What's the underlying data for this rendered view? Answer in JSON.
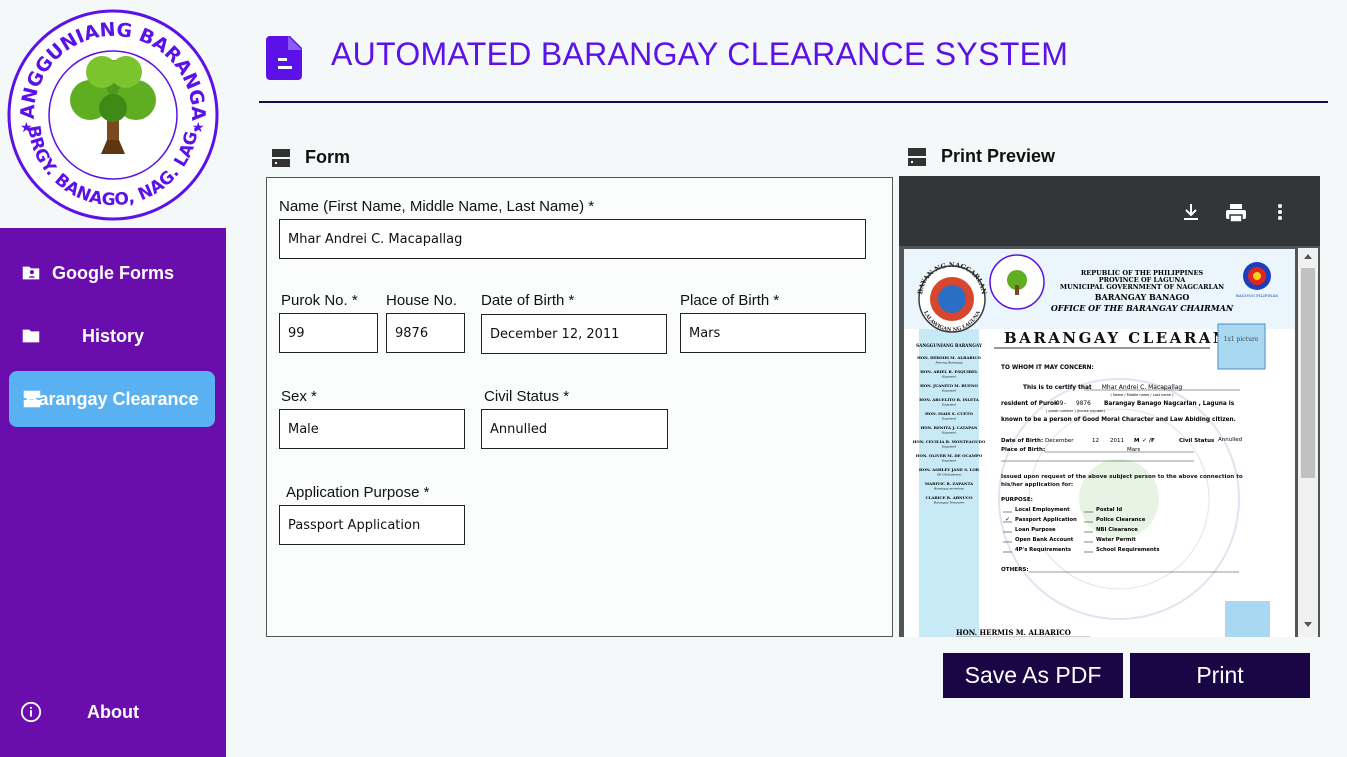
{
  "app": {
    "title": "AUTOMATED BARANGAY CLEARANCE SYSTEM"
  },
  "colors": {
    "sidebar": "#6a0dad",
    "active_item": "#5ab1f2",
    "title": "#5b11e8",
    "button": "#1a0645"
  },
  "logo": {
    "top_text": "SANGGUNIANG BARANGAY",
    "bottom_text": "BRGY. BANAGO, NAG. LAG."
  },
  "sidebar": {
    "items": [
      {
        "label": "Google Forms",
        "icon": "folder-account-icon"
      },
      {
        "label": "History",
        "icon": "folder-icon"
      },
      {
        "label": "Barangay Clearance",
        "icon": "form-icon",
        "active": true
      },
      {
        "label": "About",
        "icon": "info-icon"
      }
    ]
  },
  "form": {
    "header": "Form",
    "name": {
      "label": "Name (First Name, Middle Name, Last Name)  *",
      "value": "Mhar Andrei C. Macapallag"
    },
    "purok": {
      "label": "Purok No. *",
      "value": "99"
    },
    "house": {
      "label": "House No.",
      "value": "9876"
    },
    "dob": {
      "label": "Date of Birth *",
      "value": "December 12, 2011"
    },
    "pob": {
      "label": "Place of Birth *",
      "value": "Mars"
    },
    "sex": {
      "label": "Sex *",
      "value": "Male"
    },
    "civil": {
      "label": "Civil Status *",
      "value": "Annulled"
    },
    "purpose": {
      "label": "Application Purpose *",
      "value": "Passport Application"
    }
  },
  "preview": {
    "header": "Print Preview",
    "doc": {
      "republic": "REPUBLIC OF THE PHILIPPINES",
      "province": "PROVINCE OF LAGUNA",
      "municipal": "MUNICIPAL GOVERNMENT OF NAGCARLAN",
      "barangay": "BARANGAY BANAGO",
      "office": "OFFICE OF THE BARANGAY CHAIRMAN",
      "bagong": "BAGONG PILIPINAS",
      "seal_left": "BAYAN NG NAGCARLAN",
      "seal_left_bottom": "LALAWIGAN NG LAGUNA",
      "heading": "BARANGAY CLEARANCE",
      "photo": "1x1 picture",
      "sidebar_title": "SANGGUNIANG BARANGAY",
      "officials": [
        {
          "name": "HON. HERMIS M. ALBARICO",
          "role": "Punong Barangay"
        },
        {
          "name": "HON. ARIEL R. ESQUIBEL",
          "role": "Kagawad"
        },
        {
          "name": "HON. JUANITO M. BUENO",
          "role": "Kagawad"
        },
        {
          "name": "HON. ARCELITO R. ISLETA",
          "role": "Kagawad"
        },
        {
          "name": "HON. ISAIS S. CUETO",
          "role": "Kagawad"
        },
        {
          "name": "HON. BENITA J. CATAPAN",
          "role": "Kagawad"
        },
        {
          "name": "HON. CECILIA R. MONTEAGUDO",
          "role": "Kagawad"
        },
        {
          "name": "HON. OLIVER M. DE OCAMPO",
          "role": "Kagawad"
        },
        {
          "name": "HON. ASHLEY JANE S. LOR",
          "role": "SK Chairperson"
        },
        {
          "name": "MARIVIC R. ZAPANTA",
          "role": "Barangay secretary"
        },
        {
          "name": "CLARICE R. ABNUCO",
          "role": "Barangay Treasurer"
        }
      ],
      "to_whom": "TO WHOM IT MAY CONCERN:",
      "certify": "This is to certify that",
      "cert_name": "Mhar Andrei C. Macapallag",
      "name_hint": "( Name / Middle name / Last name )",
      "resident_of": "resident of  Purok",
      "purok": "99",
      "house": "9876",
      "resident_rest": "Barangay Banago Nagcarlan , Laguna is",
      "purok_hint": "( purok number ) (house number)",
      "known": "known to be a person of Good Moral Character and Law Abiding citizen.",
      "dob_label": "Date of Birth:",
      "dob_month": "December",
      "dob_day": "12",
      "dob_year": "2011",
      "sex_m": "M",
      "check": "✓",
      "sex_f": "/F",
      "civil_label": "Civil Status",
      "civil": "Annulled",
      "pob_label": "Place of Birth:",
      "pob": "Mars",
      "issued": "Issued upon request of the above subject person to the above connection to his/her application for:",
      "purpose_label": "PURPOSE:",
      "purposes_left": [
        "Local Employment",
        "Passport Application",
        "Loan Purpose",
        "Open Bank Account",
        "4P's Requirements"
      ],
      "purposes_right": [
        "Postal Id",
        "Police Clearance",
        "NBI Clearance",
        "Water Permit",
        "School Requirements"
      ],
      "others": "OTHERS:",
      "signatory": "HON.  HERMIS  M.  ALBARICO"
    }
  },
  "buttons": {
    "save_pdf": "Save As PDF",
    "print": "Print"
  }
}
